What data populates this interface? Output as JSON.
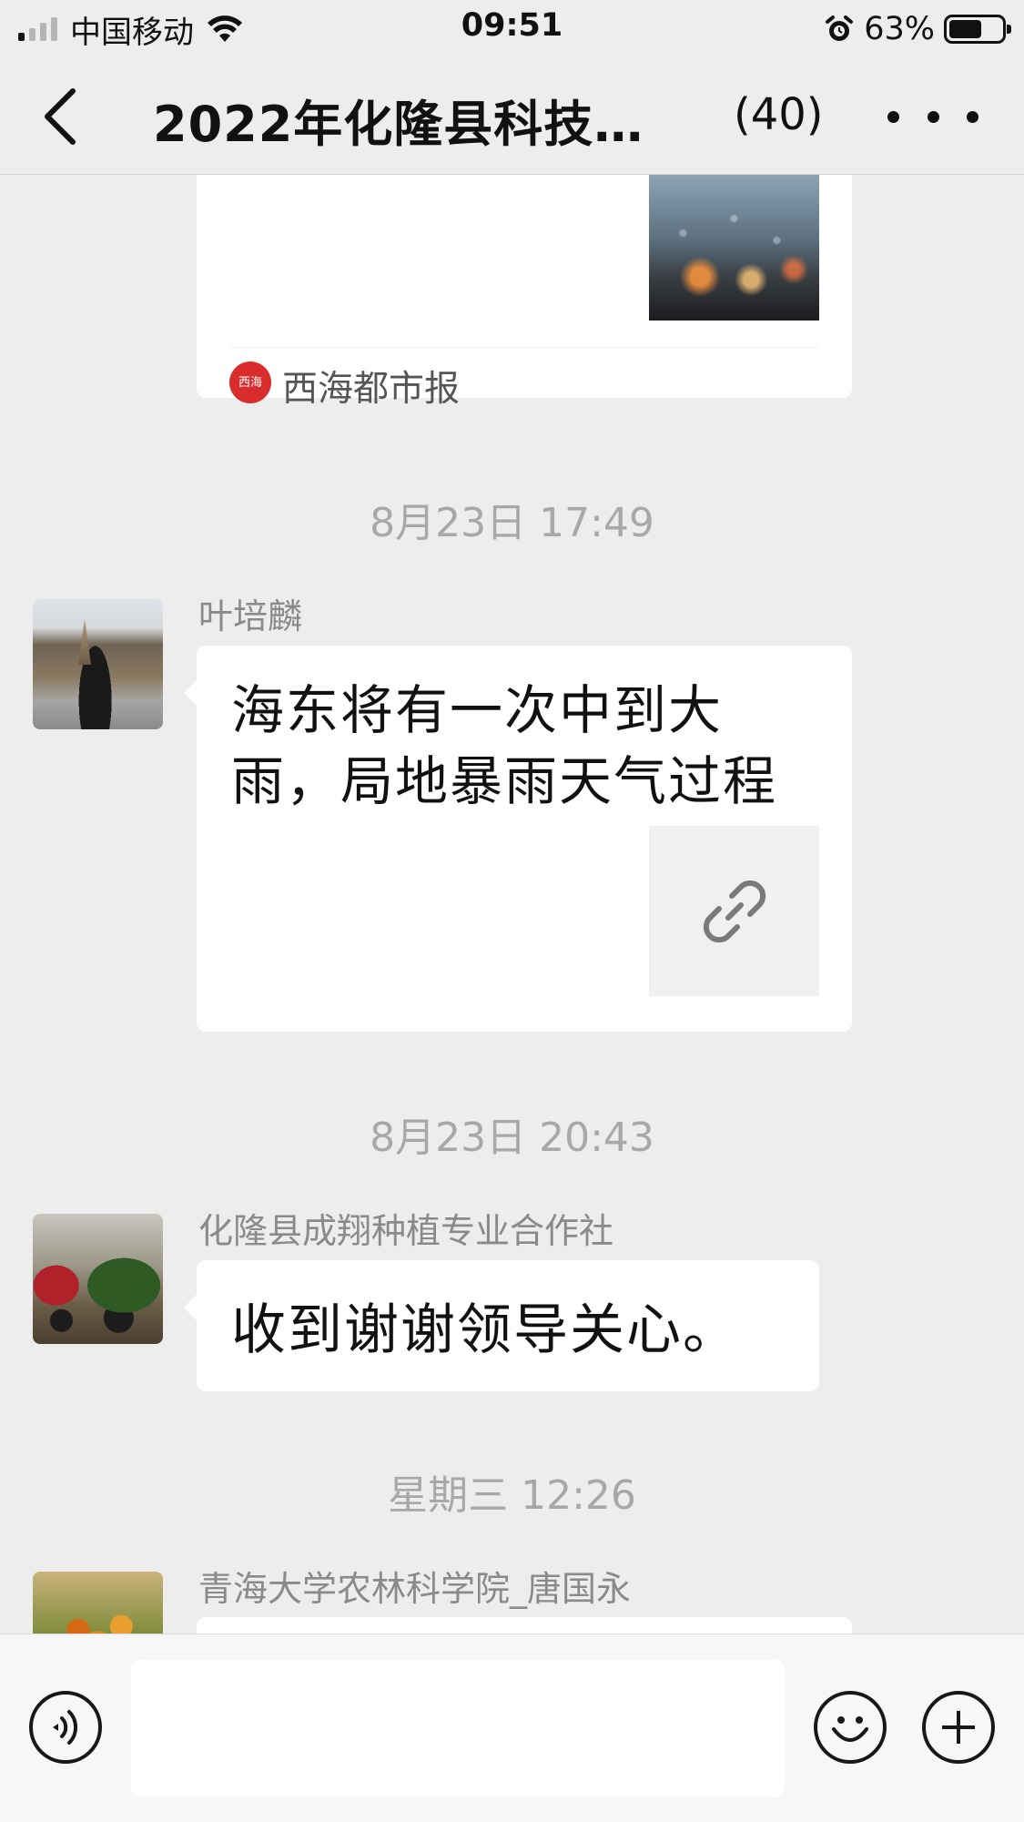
{
  "status_bar": {
    "carrier": "中国移动",
    "time": "09:51",
    "battery_percent": "63%",
    "battery_level": 0.63,
    "signal_bars_active": 1,
    "signal_bars_total": 4,
    "icons": [
      "signal-icon",
      "wifi-icon",
      "alarm-icon",
      "battery-icon"
    ]
  },
  "nav": {
    "title": "2022年化隆县科技…",
    "member_count": "(40)",
    "back_icon": "chevron-left-icon",
    "more_icon": "more-icon"
  },
  "messages": [
    {
      "type": "link-card",
      "source_name": "西海都市报",
      "source_logo_text": "西海都市报"
    },
    {
      "type": "timestamp",
      "text": "8月23日 17:49"
    },
    {
      "type": "link",
      "sender": "叶培麟",
      "title": "海东将有一次中到大雨，局地暴雨天气过程",
      "thumb_icon": "link-icon"
    },
    {
      "type": "timestamp",
      "text": "8月23日 20:43"
    },
    {
      "type": "text",
      "sender": "化隆县成翔种植专业合作社",
      "text": "收到谢谢领导关心。"
    },
    {
      "type": "timestamp",
      "text": "星期三 12:26"
    },
    {
      "type": "partial",
      "sender": "青海大学农林科学院_唐国永"
    }
  ],
  "input_bar": {
    "value": "",
    "icons": [
      "voice-icon",
      "emoji-icon",
      "plus-icon"
    ]
  },
  "colors": {
    "background": "#ededed",
    "bubble": "#ffffff",
    "timestamp": "#a8a8a8",
    "sender": "#8a8a8a",
    "source_logo": "#d92c2c"
  }
}
